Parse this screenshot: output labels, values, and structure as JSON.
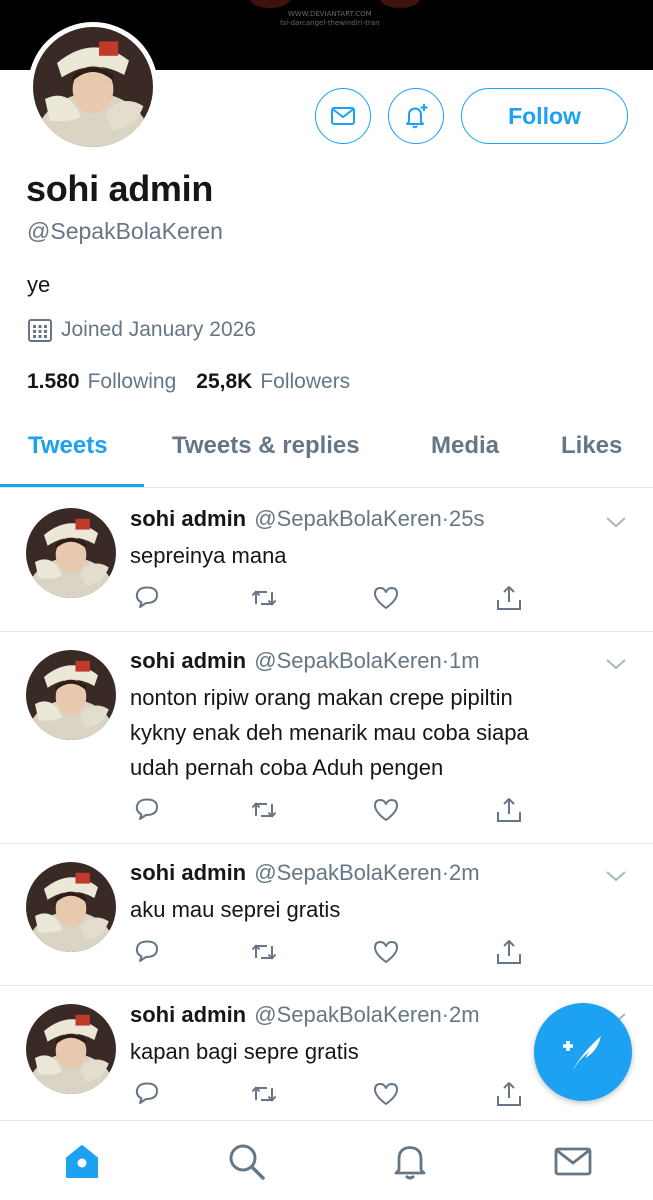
{
  "banner": {
    "watermark_line1": "WWW.DEVIANTART.COM",
    "watermark_line2": "fsl-darcangel-thewindiri-tran"
  },
  "profile": {
    "display_name": "sohi admin",
    "handle": "@SepakBolaKeren",
    "bio": "ye",
    "joined": "Joined January 2026",
    "following_count": "1.580",
    "following_label": "Following",
    "followers_count": "25,8K",
    "followers_label": "Followers",
    "follow_button": "Follow"
  },
  "tabs": [
    {
      "label": "Tweets",
      "active": true
    },
    {
      "label": "Tweets & replies",
      "active": false
    },
    {
      "label": "Media",
      "active": false
    },
    {
      "label": "Likes",
      "active": false
    }
  ],
  "tweets": [
    {
      "name": "sohi admin",
      "handle": "@SepakBolaKeren",
      "time": "25s",
      "lines": [
        "sepreinya mana"
      ]
    },
    {
      "name": "sohi admin",
      "handle": "@SepakBolaKeren",
      "time": "1m",
      "lines": [
        "nonton ripiw orang makan crepe pipiltin",
        "kykny enak deh menarik mau coba siapa",
        "udah pernah coba Aduh pengen"
      ]
    },
    {
      "name": "sohi admin",
      "handle": "@SepakBolaKeren",
      "time": "2m",
      "lines": [
        "aku mau seprei gratis"
      ]
    },
    {
      "name": "sohi admin",
      "handle": "@SepakBolaKeren",
      "time": "2m",
      "lines": [
        "kapan bagi sepre gratis"
      ]
    }
  ],
  "icons": {
    "message": "envelope-icon",
    "notifications": "bell-plus-icon",
    "calendar": "calendar-icon",
    "reply": "reply-icon",
    "retweet": "retweet-icon",
    "like": "heart-icon",
    "share": "share-icon",
    "compose": "compose-feather-icon",
    "nav": [
      "home-icon",
      "search-icon",
      "notifications-icon",
      "messages-icon"
    ]
  },
  "colors": {
    "accent": "#1da1f2",
    "secondary_text": "#657786",
    "divider": "#e1e8ed"
  }
}
